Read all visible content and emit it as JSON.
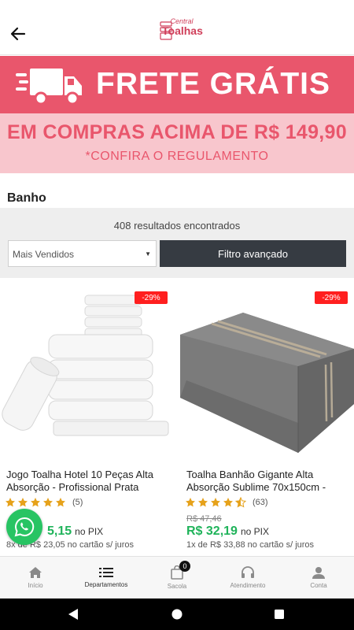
{
  "header": {
    "logo_line1": "Central",
    "logo_line2": "Toalhas"
  },
  "banner": {
    "title": "FRETE GRÁTIS",
    "subtitle": "EM COMPRAS ACIMA DE R$ 149,90",
    "note": "*CONFIRA O REGULAMENTO"
  },
  "category": "Banho",
  "filters": {
    "results": "408 resultados encontrados",
    "sort_value": "Mais Vendidos",
    "advanced_label": "Filtro avançado"
  },
  "products": [
    {
      "discount": "-29%",
      "name": "Jogo Toalha Hotel 10 Peças Alta Absorção - Profissional Prata",
      "rating": 5,
      "rating_count": "(5)",
      "price": "R$ 65,15",
      "price_visible": "5,15",
      "pix": "no PIX",
      "installments": "8x de R$ 23,05 no cartão s/ juros"
    },
    {
      "discount": "-29%",
      "name": "Toalha Banhão Gigante Alta Absorção Sublime 70x150cm -",
      "rating": 4.5,
      "rating_count": "(63)",
      "old_price": "R$ 47,46",
      "price": "R$ 32,19",
      "pix": "no PIX",
      "installments": "1x de R$ 33,88 no cartão s/ juros"
    }
  ],
  "bottom_nav": {
    "items": [
      {
        "label": "Início",
        "icon": "home-icon"
      },
      {
        "label": "Departamentos",
        "icon": "list-icon"
      },
      {
        "label": "Sacola",
        "icon": "bag-icon"
      },
      {
        "label": "Atendimento",
        "icon": "headset-icon"
      },
      {
        "label": "Conta",
        "icon": "user-icon"
      }
    ],
    "cart_count": "0"
  },
  "colors": {
    "brand": "#e9566c",
    "price": "#1fb35a",
    "badge": "#ff1f1f",
    "whatsapp": "#28c463"
  }
}
